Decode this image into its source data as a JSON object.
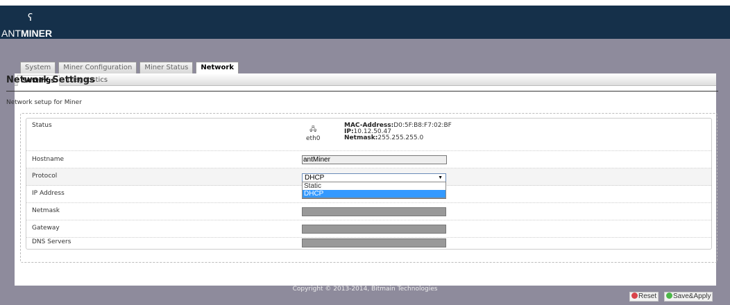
{
  "brand": {
    "logo": "ANTMINER"
  },
  "tabs": [
    "System",
    "Miner Configuration",
    "Miner Status",
    "Network"
  ],
  "subtabs": [
    "Settings",
    "Diagnostics"
  ],
  "title": "Network Settings",
  "description": "Network setup for Miner",
  "status": {
    "label": "Status",
    "iface": "eth0",
    "mac_label": "MAC-Address:",
    "mac": "D0:5F:B8:F7:02:BF",
    "ip_label": "IP:",
    "ip": "10.12.50.47",
    "netmask_label": "Netmask:",
    "netmask": "255.255.255.0"
  },
  "fields": {
    "hostname": {
      "label": "Hostname",
      "value": "antMiner"
    },
    "protocol": {
      "label": "Protocol",
      "value": "DHCP",
      "options": [
        "Static",
        "DHCP"
      ]
    },
    "ip": {
      "label": "IP Address"
    },
    "netmask": {
      "label": "Netmask"
    },
    "gateway": {
      "label": "Gateway"
    },
    "dns": {
      "label": "DNS Servers"
    }
  },
  "buttons": {
    "reset": "Reset",
    "save": "Save&Apply"
  },
  "footer": "Copyright © 2013-2014, Bitmain Technologies"
}
